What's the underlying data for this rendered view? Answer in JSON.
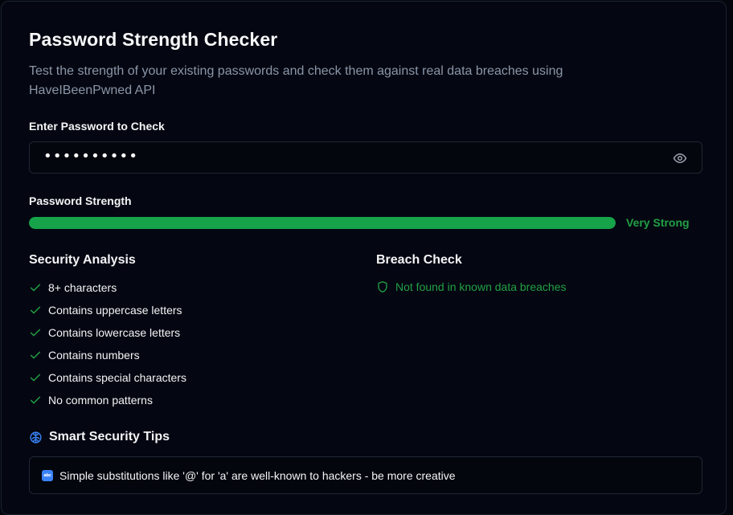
{
  "header": {
    "title": "Password Strength Checker",
    "subtitle": "Test the strength of your existing passwords and check them against real data breaches using HaveIBeenPwned API"
  },
  "password_field": {
    "label": "Enter Password to Check",
    "masked_value": "••••••••••",
    "toggle_icon": "eye-icon"
  },
  "strength": {
    "label": "Password Strength",
    "level_text": "Very Strong",
    "progress_percent": 100,
    "color": "#16a34a"
  },
  "security_analysis": {
    "title": "Security Analysis",
    "items": [
      {
        "label": "8+ characters",
        "passed": true
      },
      {
        "label": "Contains uppercase letters",
        "passed": true
      },
      {
        "label": "Contains lowercase letters",
        "passed": true
      },
      {
        "label": "Contains numbers",
        "passed": true
      },
      {
        "label": "Contains special characters",
        "passed": true
      },
      {
        "label": "No common patterns",
        "passed": true
      }
    ]
  },
  "breach_check": {
    "title": "Breach Check",
    "result": "Not found in known data breaches",
    "icon": "shield-icon",
    "color": "#22a045"
  },
  "tips": {
    "title": "Smart Security Tips",
    "icon": "brain-icon",
    "items": [
      {
        "icon": "abc-icon",
        "text": "Simple substitutions like '@' for 'a' are well-known to hackers - be more creative"
      }
    ]
  }
}
